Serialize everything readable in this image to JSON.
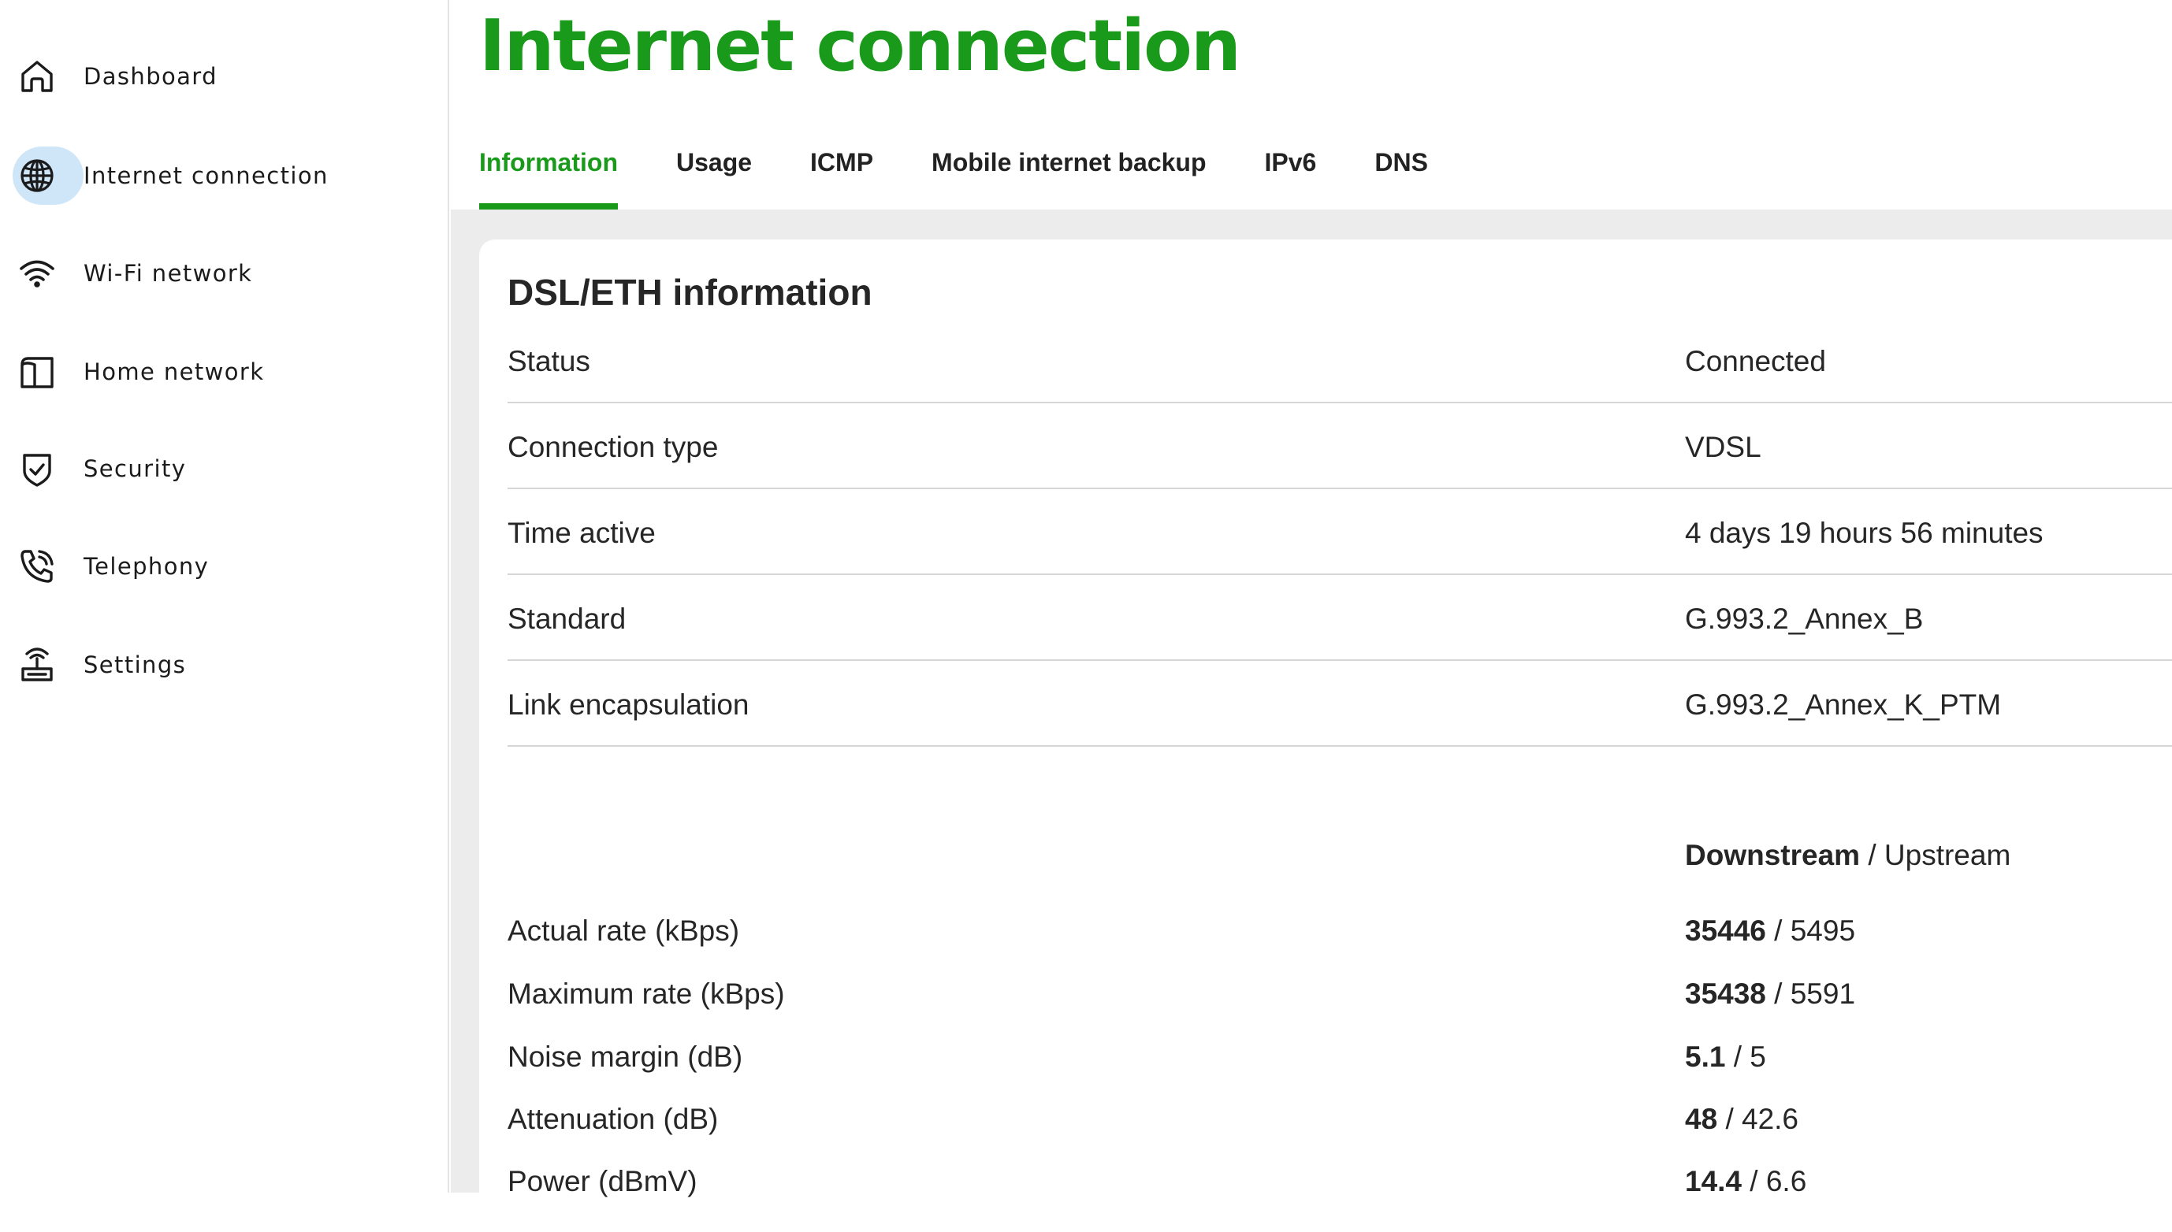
{
  "sidebar": {
    "items": [
      {
        "label": "Dashboard",
        "icon": "home-icon",
        "active": false
      },
      {
        "label": "Internet connection",
        "icon": "globe-icon",
        "active": true
      },
      {
        "label": "Wi-Fi network",
        "icon": "wifi-icon",
        "active": false
      },
      {
        "label": "Home network",
        "icon": "home-network-icon",
        "active": false
      },
      {
        "label": "Security",
        "icon": "shield-check-icon",
        "active": false
      },
      {
        "label": "Telephony",
        "icon": "phone-icon",
        "active": false
      },
      {
        "label": "Settings",
        "icon": "router-icon",
        "active": false
      }
    ]
  },
  "page": {
    "title": "Internet connection"
  },
  "tabs": [
    {
      "label": "Information",
      "active": true
    },
    {
      "label": "Usage",
      "active": false
    },
    {
      "label": "ICMP",
      "active": false
    },
    {
      "label": "Mobile internet backup",
      "active": false
    },
    {
      "label": "IPv6",
      "active": false
    },
    {
      "label": "DNS",
      "active": false
    }
  ],
  "card": {
    "title": "DSL/ETH information",
    "rows": [
      {
        "label": "Status",
        "value": "Connected"
      },
      {
        "label": "Connection type",
        "value": "VDSL"
      },
      {
        "label": "Time active",
        "value": "4 days 19 hours 56 minutes"
      },
      {
        "label": "Standard",
        "value": "G.993.2_Annex_B"
      },
      {
        "label": "Link encapsulation",
        "value": "G.993.2_Annex_K_PTM"
      }
    ],
    "stream_header": {
      "downstream": "Downstream",
      "separator": "/",
      "upstream": "Upstream"
    },
    "stats": [
      {
        "label": "Actual rate (kBps)",
        "down": "35446",
        "up": "5495"
      },
      {
        "label": "Maximum rate (kBps)",
        "down": "35438",
        "up": "5591"
      },
      {
        "label": "Noise margin (dB)",
        "down": "5.1",
        "up": "5"
      },
      {
        "label": "Attenuation (dB)",
        "down": "48",
        "up": "42.6"
      },
      {
        "label": "Power (dBmV)",
        "down": "14.4",
        "up": "6.6"
      }
    ]
  },
  "colors": {
    "accent": "#1a9a1a",
    "active_nav_bubble": "#cfe6f8",
    "content_background": "#ececec"
  }
}
